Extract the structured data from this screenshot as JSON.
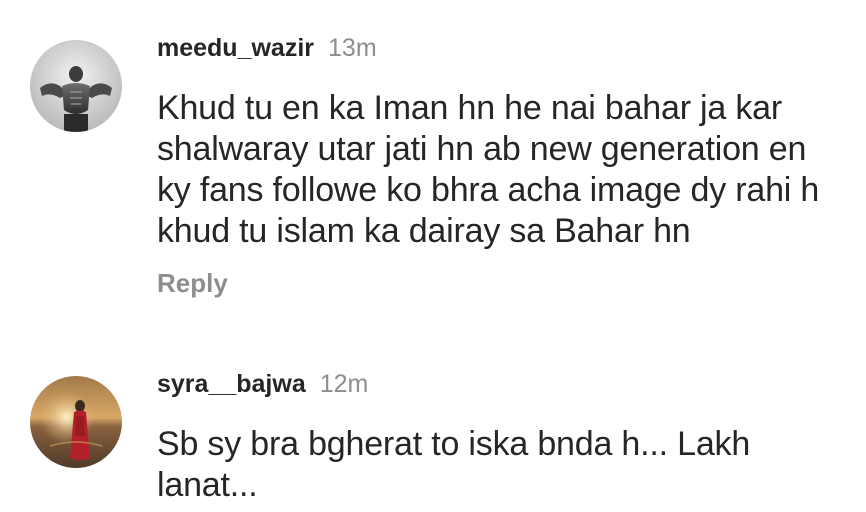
{
  "comments": [
    {
      "avatar_icon": "user-avatar-flexing-man",
      "username": "meedu_wazir",
      "time": "13m",
      "text_lines": [
        "Khud tu en ka Iman hn he nai bahar ja kar",
        "shalwaray utar jati hn ab new generation en",
        "ky fans followe ko bhra acha image dy rahi h",
        "khud tu islam ka dairay sa Bahar hn"
      ],
      "reply_label": "Reply"
    },
    {
      "avatar_icon": "user-avatar-woman-sunset",
      "username": "syra__bajwa",
      "time": "12m",
      "text_lines": [
        "Sb sy bra bgherat to iska bnda h... Lakh",
        "lanat..."
      ]
    }
  ],
  "colors": {
    "text": "#262626",
    "secondary": "#8e8e8e"
  }
}
